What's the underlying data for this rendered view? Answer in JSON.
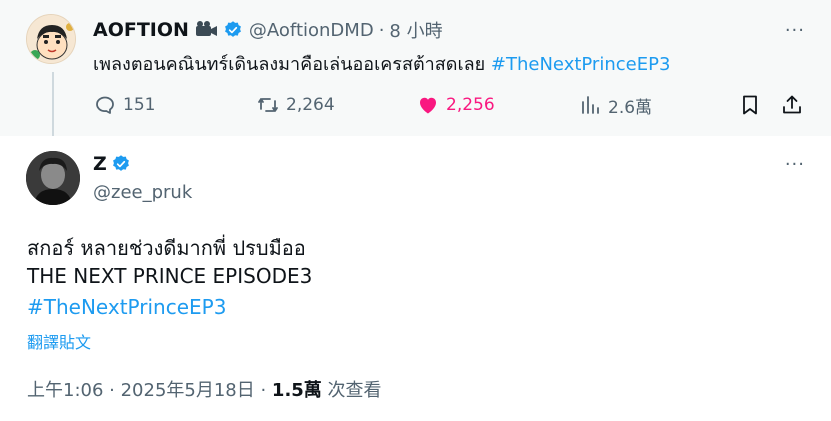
{
  "parent_tweet": {
    "display_name": "AOFTION",
    "handle": "@AoftionDMD",
    "separator": "·",
    "time": "8 小時",
    "text": "เพลงตอนคณินทร์เดินลงมาคือเล่นออเครสต้าสดเลย",
    "hashtag": "#TheNextPrinceEP3",
    "more": "···",
    "actions": {
      "reply_count": "151",
      "retweet_count": "2,264",
      "like_count": "2,256",
      "views_count": "2.6萬"
    },
    "emoji": "camera-icon"
  },
  "main_tweet": {
    "display_name": "Z",
    "handle": "@zee_pruk",
    "more": "···",
    "line1": "สกอร์ หลายช่วงดีมากพี่ ปรบมืออ",
    "line2": "THE NEXT PRINCE EPISODE3",
    "hashtag": "#TheNextPrinceEP3",
    "translate": "翻譯貼文",
    "timestamp": "上午1:06 · 2025年5月18日 · ",
    "views_bold": "1.5萬",
    "views_suffix": " 次查看"
  },
  "colors": {
    "accent": "#1d9bf0",
    "like": "#f91880",
    "muted": "#536471",
    "text": "#0f1419",
    "parent_bg": "#f7f9f9"
  }
}
